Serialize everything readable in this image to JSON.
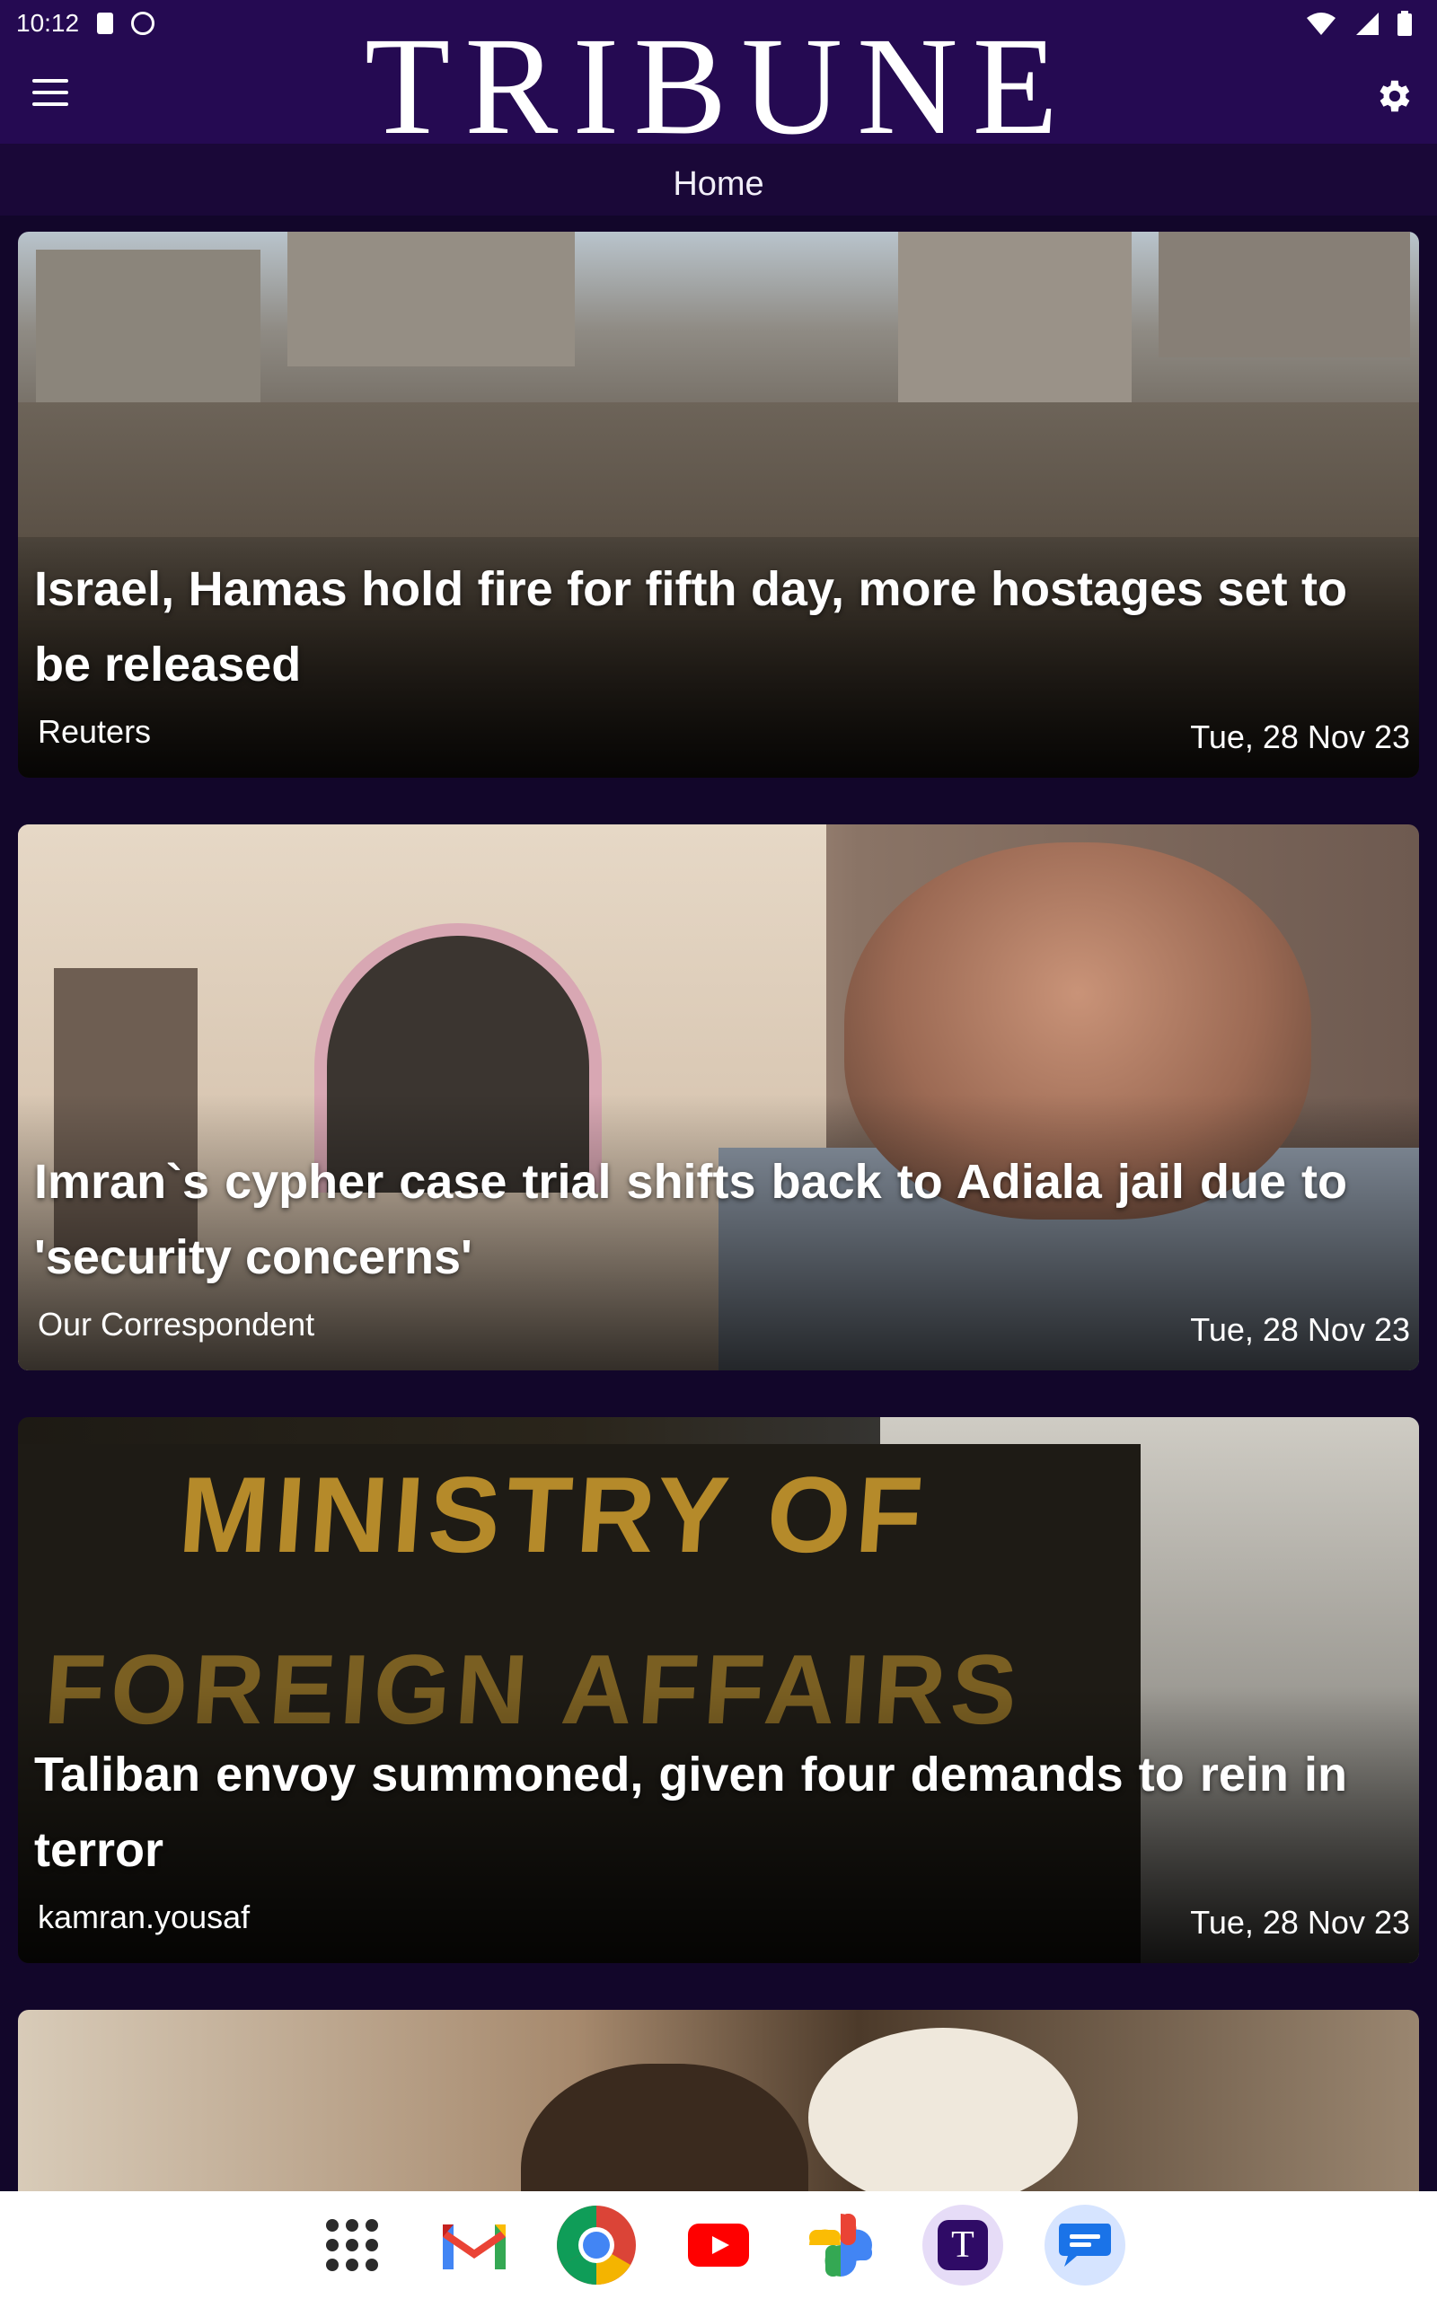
{
  "status_bar": {
    "time": "10:12"
  },
  "app_bar": {
    "brand": "TRIBUNE",
    "section": "Home"
  },
  "articles": [
    {
      "headline": "Israel, Hamas hold fire for fifth day, more hostages set to be released",
      "source": "Reuters",
      "date": "Tue, 28 Nov 23"
    },
    {
      "headline": "Imran`s cypher case trial shifts back to Adiala jail due to 'security concerns'",
      "source": "Our Correspondent",
      "date": "Tue, 28 Nov 23"
    },
    {
      "headline": "Taliban envoy summoned, given four demands to rein in terror",
      "source": "kamran.yousaf",
      "date": "Tue, 28 Nov 23"
    }
  ],
  "article_images": {
    "ministry_sign_line1": "MINISTRY OF",
    "ministry_sign_line2": "FOREIGN AFFAIRS"
  },
  "dock": {
    "apps": [
      "app-drawer-icon",
      "gmail-icon",
      "chrome-icon",
      "youtube-icon",
      "photos-icon",
      "tribune-icon",
      "messages-icon"
    ],
    "tribune_letter": "T"
  },
  "colors": {
    "app_bar": "#250a52",
    "background": "#12062a",
    "accent": "#7a3fd0"
  }
}
